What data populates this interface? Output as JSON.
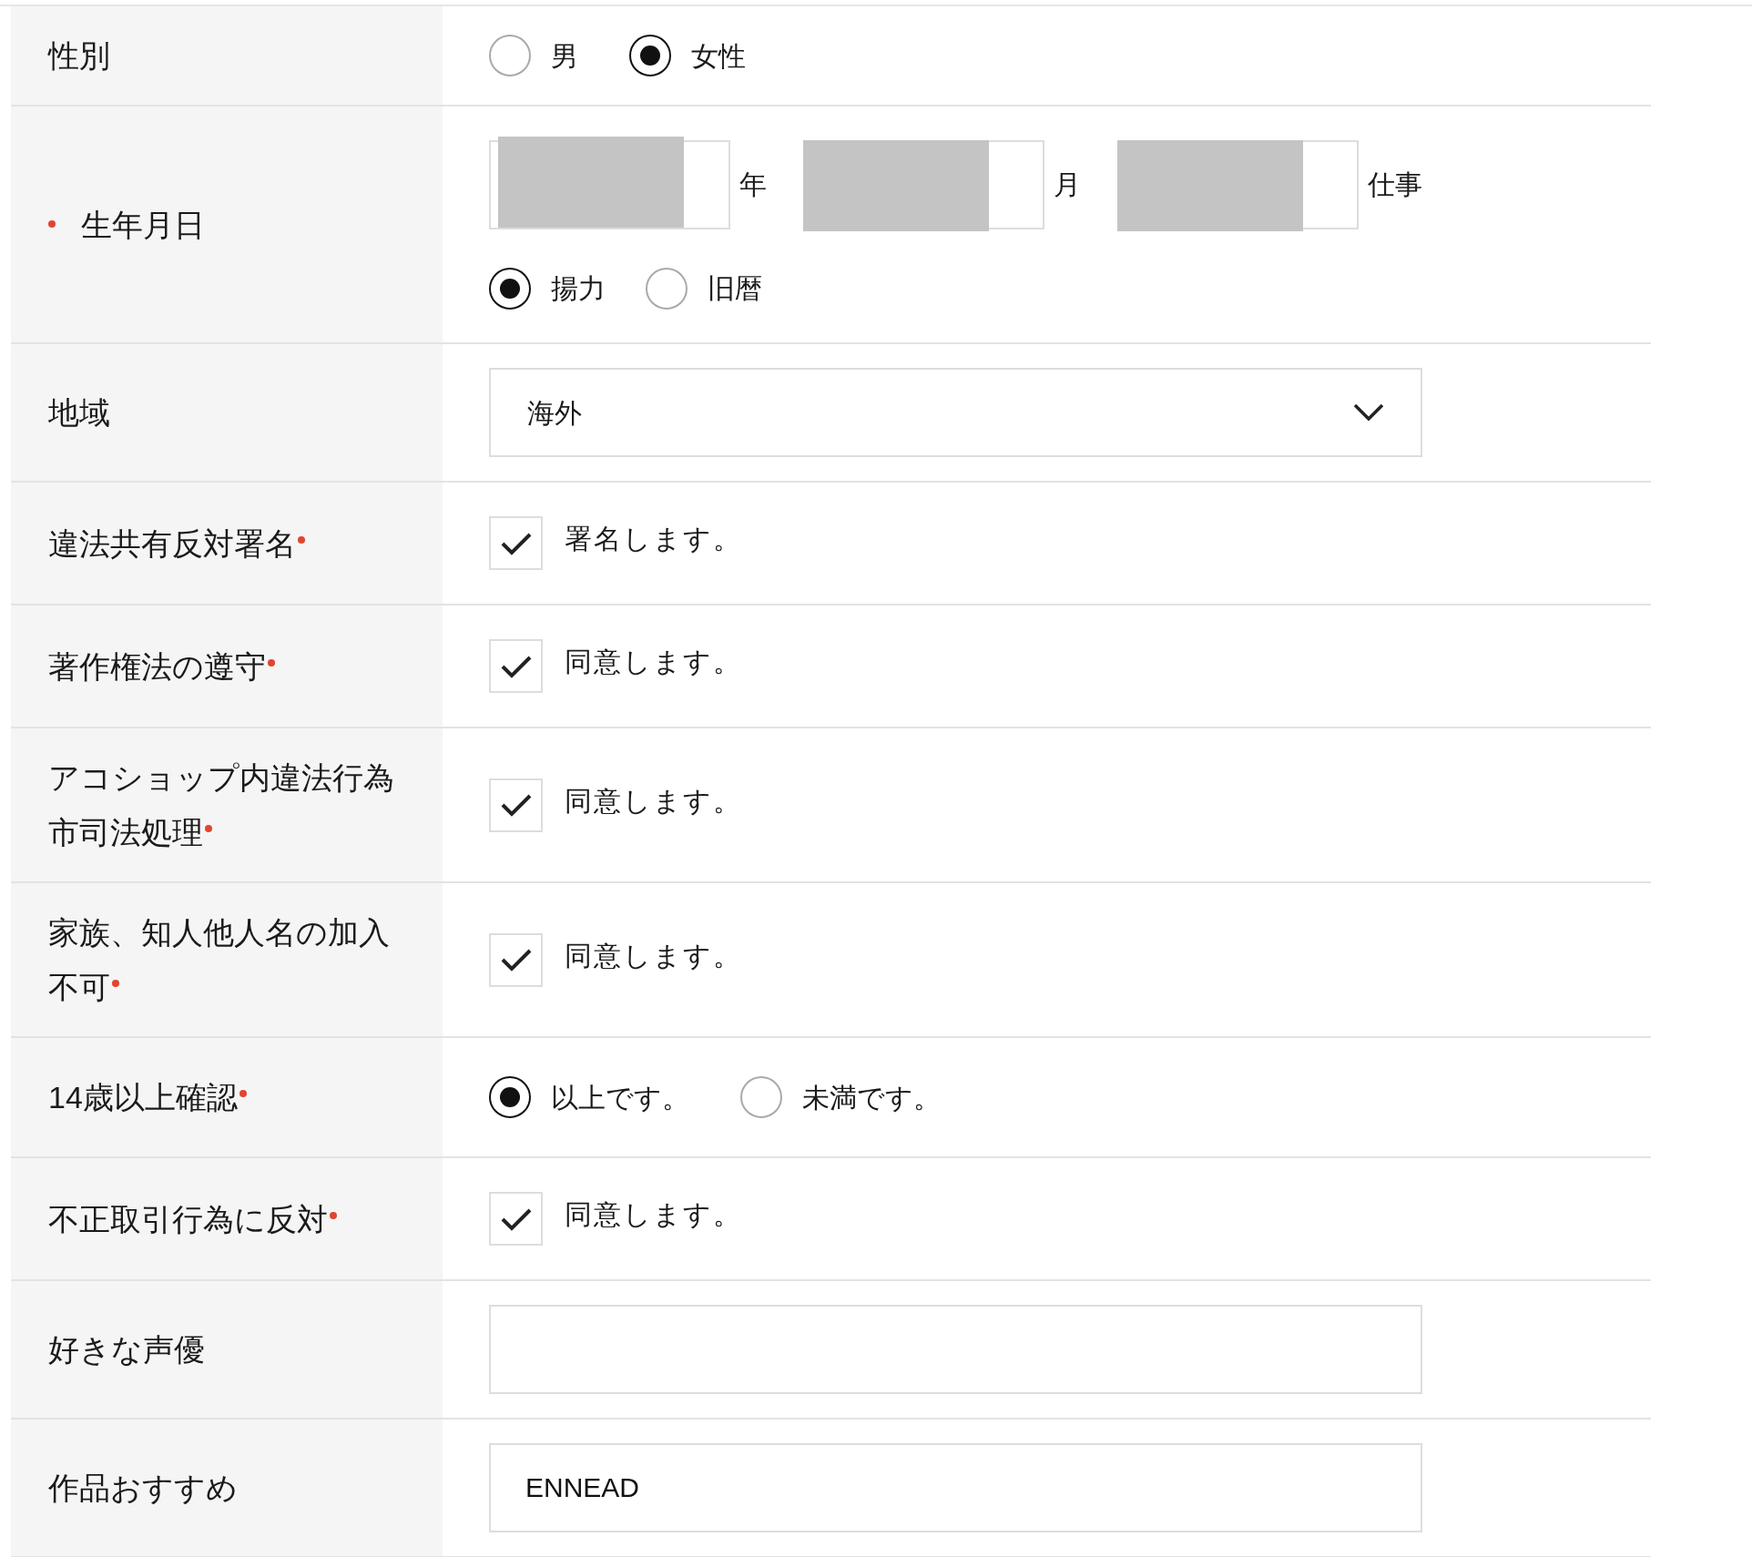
{
  "rows": [
    {
      "kind": "radio",
      "label": "性別",
      "required": false,
      "options": [
        {
          "label": "男",
          "selected": false
        },
        {
          "label": "女性",
          "selected": true
        }
      ]
    },
    {
      "kind": "date",
      "label": "生年月日",
      "required": true,
      "mark_first": true,
      "units": [
        "年",
        "月",
        "仕事"
      ],
      "options": [
        {
          "label": "揚力",
          "selected": true
        },
        {
          "label": "旧暦",
          "selected": false
        }
      ]
    },
    {
      "kind": "select",
      "label": "地域",
      "required": false,
      "value": "海外"
    },
    {
      "kind": "checkbox",
      "label": "違法共有反対署名",
      "required": true,
      "text": "署名します。",
      "checked": true
    },
    {
      "kind": "checkbox",
      "label": "著作権法の遵守",
      "required": true,
      "text": "同意します。",
      "checked": true
    },
    {
      "kind": "checkbox",
      "label": "アコショップ内違法行為市司法処理",
      "required": true,
      "text": "同意します。",
      "checked": true
    },
    {
      "kind": "checkbox",
      "label": "家族、知人他人名の加入不可",
      "required": true,
      "text": "同意します。",
      "checked": true
    },
    {
      "kind": "radio",
      "label": "14歳以上確認",
      "required": true,
      "options": [
        {
          "label": "以上です。",
          "selected": true
        },
        {
          "label": "未満です。",
          "selected": false
        }
      ]
    },
    {
      "kind": "checkbox",
      "label": "不正取引行為に反対",
      "required": true,
      "text": "同意します。",
      "checked": true
    },
    {
      "kind": "text",
      "label": "好きな声優",
      "required": false
    },
    {
      "kind": "text",
      "label": "作品おすすめ",
      "required": false,
      "value": "ENNEAD"
    }
  ]
}
